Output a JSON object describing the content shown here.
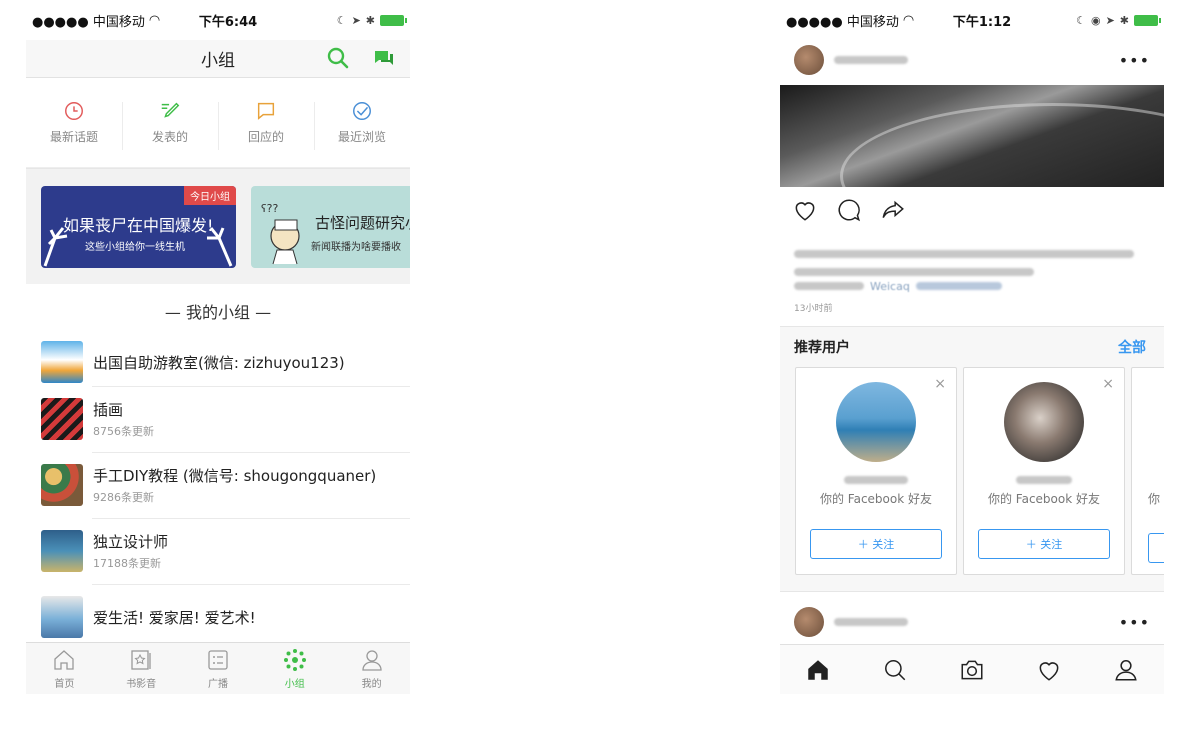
{
  "left": {
    "status": {
      "carrier": "●●●●● 中国移动",
      "time": "下午6:44"
    },
    "nav": {
      "title": "小组",
      "search_icon": "search-icon",
      "chat_icon": "chat-icon"
    },
    "quick": [
      {
        "label": "最新话题",
        "icon": "clock-icon",
        "color": "#e25b5b"
      },
      {
        "label": "发表的",
        "icon": "pencil-icon",
        "color": "#3fbd48"
      },
      {
        "label": "回应的",
        "icon": "comment-icon",
        "color": "#e8a23a"
      },
      {
        "label": "最近浏览",
        "icon": "check-circle-icon",
        "color": "#4a8fd6"
      }
    ],
    "banners": [
      {
        "tag": "今日小组",
        "title": "如果丧尸在中国爆发!",
        "subtitle": "这些小组给你一线生机"
      },
      {
        "title": "古怪问题研究小",
        "subtitle": "新闻联播为啥要播收"
      }
    ],
    "section_title": "— 我的小组 —",
    "groups": [
      {
        "name": "出国自助游教室(微信: zizhuyou123)",
        "meta": ""
      },
      {
        "name": "插画",
        "meta": "8756条更新"
      },
      {
        "name": "手工DIY教程 (微信号: shougongquaner)",
        "meta": "9286条更新"
      },
      {
        "name": "独立设计师",
        "meta": "17188条更新"
      },
      {
        "name": "爱生活! 爱家居! 爱艺术!",
        "meta": ""
      }
    ],
    "tabs": [
      {
        "label": "首页",
        "icon": "home-icon"
      },
      {
        "label": "书影音",
        "icon": "media-icon"
      },
      {
        "label": "广播",
        "icon": "broadcast-icon"
      },
      {
        "label": "小组",
        "icon": "group-icon",
        "active": true
      },
      {
        "label": "我的",
        "icon": "profile-icon"
      }
    ]
  },
  "right": {
    "status": {
      "carrier": "●●●●● 中国移动",
      "time": "下午1:12"
    },
    "post": {
      "more": "•••",
      "caption_visible_word": "Weicaq",
      "time_ago": "13小时前"
    },
    "suggest": {
      "title": "推荐用户",
      "see_all": "全部",
      "cards": [
        {
          "close": "×",
          "subtitle": "你的 Facebook 好友",
          "follow": "＋ 关注"
        },
        {
          "close": "×",
          "subtitle": "你的 Facebook 好友",
          "follow": "＋ 关注"
        }
      ],
      "partial_card_text": "你"
    },
    "tabs": [
      {
        "icon": "home-icon"
      },
      {
        "icon": "search-icon"
      },
      {
        "icon": "camera-icon"
      },
      {
        "icon": "heart-icon"
      },
      {
        "icon": "profile-icon"
      }
    ],
    "colors": {
      "link_blue": "#3897f0",
      "douban_green": "#3fbd48"
    }
  }
}
